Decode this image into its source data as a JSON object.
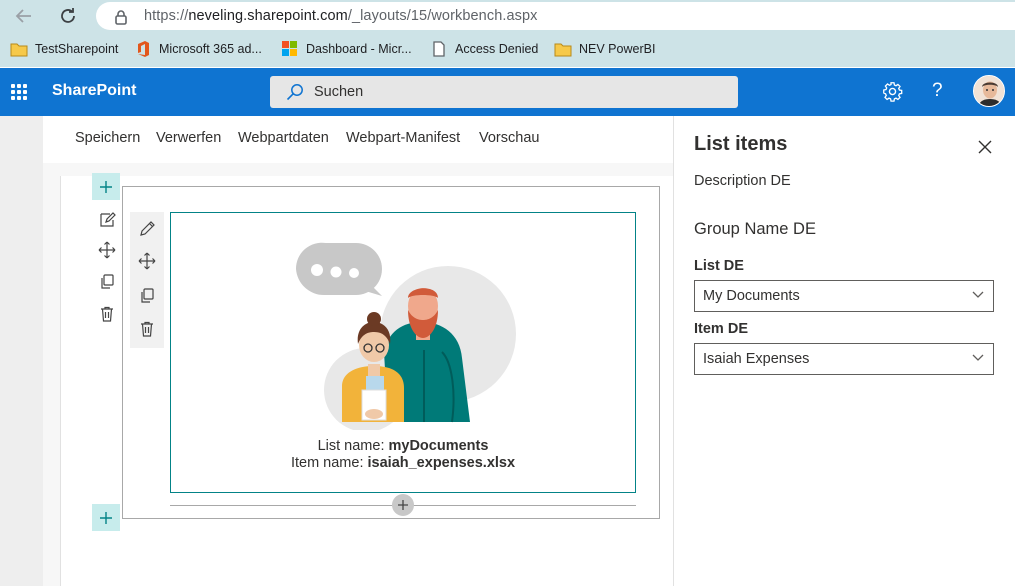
{
  "browser": {
    "url_prefix": "https://",
    "url_host": "neveling.sharepoint.com",
    "url_path": "/_layouts/15/workbench.aspx"
  },
  "bookmarks": [
    {
      "label": "TestSharepoint",
      "icon": "folder-icon"
    },
    {
      "label": "Microsoft 365 ad...",
      "icon": "office-icon"
    },
    {
      "label": "Dashboard - Micr...",
      "icon": "microsoft-icon"
    },
    {
      "label": "Access Denied",
      "icon": "page-icon"
    },
    {
      "label": "NEV PowerBI",
      "icon": "folder-icon"
    }
  ],
  "suite": {
    "brand": "SharePoint",
    "search_placeholder": "Suchen",
    "help_label": "?"
  },
  "toolbar": {
    "save": "Speichern",
    "discard": "Verwerfen",
    "webpart_data": "Webpartdaten",
    "manifest": "Webpart-Manifest",
    "preview": "Vorschau"
  },
  "webpart": {
    "list_label": "List name: ",
    "list_value": "myDocuments",
    "item_label": "Item name: ",
    "item_value": "isaiah_expenses.xlsx"
  },
  "pane": {
    "title": "List items",
    "description": "Description DE",
    "group_name": "Group Name DE",
    "list_label": "List DE",
    "list_value": "My Documents",
    "item_label": "Item DE",
    "item_value": "Isaiah Expenses"
  },
  "colors": {
    "suite_bar": "#0f74d1",
    "accent_teal": "#038387",
    "browser_chrome": "#cde3e7"
  }
}
